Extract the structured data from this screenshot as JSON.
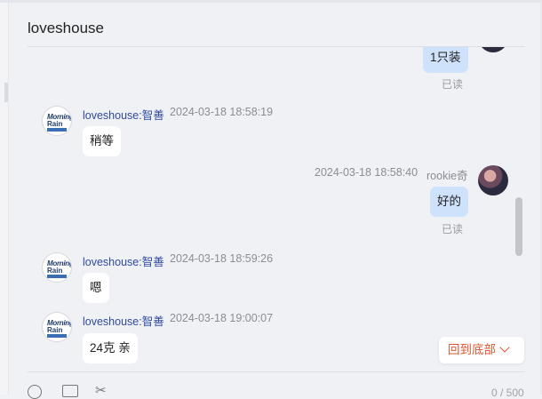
{
  "chat": {
    "title": "loveshouse"
  },
  "messages": [
    {
      "side": "out",
      "text": "1只装",
      "status": "已读"
    },
    {
      "side": "in",
      "sender": "loveshouse:智善",
      "time": "2024-03-18 18:58:19",
      "text": "稍等"
    },
    {
      "side": "out",
      "sender": "rookie奇",
      "time": "2024-03-18 18:58:40",
      "text": "好的",
      "status": "已读"
    },
    {
      "side": "in",
      "sender": "loveshouse:智善",
      "time": "2024-03-18 18:59:26",
      "text": "嗯"
    },
    {
      "side": "in",
      "sender": "loveshouse:智善",
      "time": "2024-03-18 19:00:07",
      "text": "24克 亲"
    }
  ],
  "avatar_logo": {
    "line1": "Morning",
    "line2": "Rain"
  },
  "scroll_to_bottom": {
    "label": "回到底部"
  },
  "composer": {
    "counter": "0 / 500"
  },
  "colors": {
    "accent": "#e2532f",
    "sender": "#2f4ba1",
    "bubble_out": "#cfe2fb",
    "background": "#f0f1f5"
  },
  "icons": {
    "emoji": "emoji-icon",
    "image": "image-icon",
    "cut": "scissors-icon",
    "down": "chevron-down-icon"
  }
}
